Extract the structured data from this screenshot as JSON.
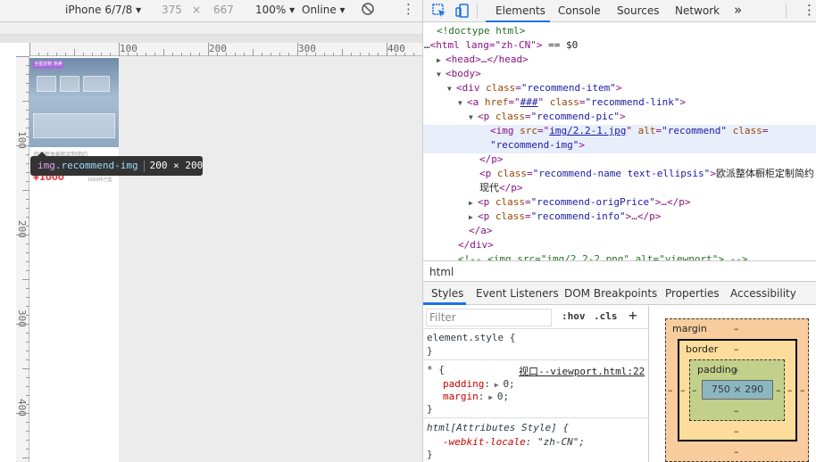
{
  "device_toolbar": {
    "device": "iPhone 6/7/8",
    "width": "375",
    "times": "×",
    "height": "667",
    "zoom": "100%",
    "network": "Online",
    "more": "⋮"
  },
  "rulers": {
    "top_labels": [
      "100",
      "200",
      "300",
      "400"
    ],
    "left_labels": [
      "100",
      "200",
      "300",
      "400"
    ]
  },
  "product": {
    "tag": "全屋定制 热卖",
    "name": "欧派整体橱柜定制简约",
    "price": "¥1000",
    "info": "1669件已售"
  },
  "tooltip": {
    "tag": "img",
    "cls": ".recommend-img",
    "size": "200 × 200"
  },
  "devtools": {
    "tabs": [
      "Elements",
      "Console",
      "Sources",
      "Network"
    ],
    "overflow": "»",
    "more": "⋮"
  },
  "dom": {
    "doctype": "<!doctype html>",
    "html_open": "<html lang=\"zh-CN\">",
    "html_sel": "== $0",
    "head": "<head>…</head>",
    "body": "<body>",
    "div_tag": "<div ",
    "div_attr": "class",
    "div_val": "\"recommend-item\"",
    "a_tag": "<a ",
    "a_href": "href",
    "a_href_val": "###",
    "a_cls": "class",
    "a_cls_val": "\"recommend-link\"",
    "p_tag": "<p ",
    "p_cls": "class",
    "p_cls_val": "\"recommend-pic\"",
    "img_tag": "<img ",
    "img_src": "src",
    "img_src_val": "img/2.2-1.jpg",
    "img_alt": "alt",
    "img_alt_val": "\"recommend\"",
    "img_cls": "class",
    "img_cls_val": "\"recommend-img\"",
    "p_close": "</p>",
    "name_cls_val": "\"recommend-name text-ellipsis\"",
    "name_text1": "欧派整体橱柜定制简约",
    "name_text2": "现代",
    "orig_val": "\"recommend-origPrice\"",
    "info_val": "\"recommend-info\"",
    "a_close": "</a>",
    "div_close": "</div>",
    "comment": "<!-- <img src=\"img/2.2-2.png\" alt=\"viewport\"> -->"
  },
  "breadcrumb": "html",
  "subtabs": [
    "Styles",
    "Event Listeners",
    "DOM Breakpoints",
    "Properties",
    "Accessibility"
  ],
  "styles": {
    "filter_placeholder": "Filter",
    "hov": ":hov",
    "cls": ".cls",
    "add": "+",
    "element_style": "element.style {",
    "close": "}",
    "star": "* {",
    "source": "视口--viewport.html:22",
    "padding_prop": "padding",
    "padding_val": "0;",
    "margin_prop": "margin",
    "margin_val": "0;",
    "attr_style": "html[Attributes Style] {",
    "locale_prop": "-webkit-locale",
    "locale_val": "\"zh-CN\";"
  },
  "box_model": {
    "margin": "margin",
    "border": "border",
    "padding": "padding",
    "content": "750 × 290",
    "dash": "–"
  }
}
